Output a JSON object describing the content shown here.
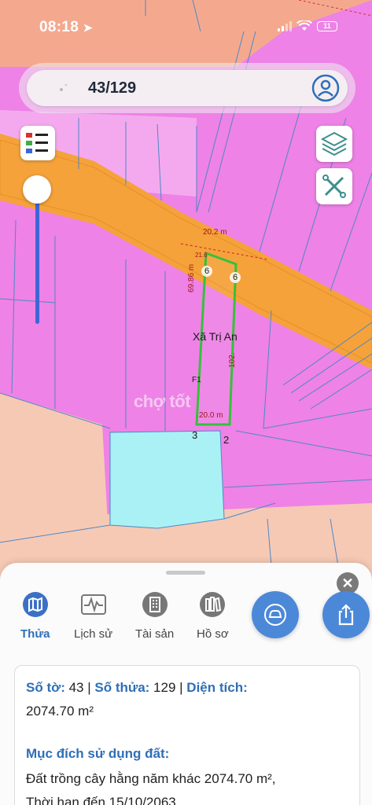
{
  "status_bar": {
    "time": "08:18",
    "battery": "11"
  },
  "search": {
    "value": "43/129"
  },
  "map": {
    "commune_label": "Xã Trị An",
    "watermark": "chợ tốt",
    "dimensions": {
      "top": "20.2 m",
      "left": "69.86 m",
      "right": "102.",
      "bottom": "20.0 m",
      "left_top": "21.6"
    },
    "parcel_numbers": [
      "6",
      "6",
      "3",
      "2",
      "F1"
    ]
  },
  "tabs": [
    {
      "label": "Thửa",
      "icon": "map-icon",
      "active": true
    },
    {
      "label": "Lịch sử",
      "icon": "history-chart-icon",
      "active": false
    },
    {
      "label": "Tài sản",
      "icon": "building-icon",
      "active": false
    },
    {
      "label": "Hồ sơ",
      "icon": "books-icon",
      "active": false
    }
  ],
  "actions": {
    "car": "car-icon",
    "share": "share-icon"
  },
  "info": {
    "so_to_label": "Số tờ:",
    "so_to_value": "43",
    "so_thua_label": "Số thửa:",
    "so_thua_value": "129",
    "dien_tich_label": "Diện tích:",
    "dien_tich_value": "2074.70 m²",
    "muc_dich_label": "Mục đích sử dụng đất:",
    "muc_dich_value": "Đất trồng cây hằng năm khác 2074.70 m²,",
    "thoi_han": "Thời hạn đến 15/10/2063"
  },
  "colors": {
    "land_pink": "#ee82e6",
    "road_orange": "#f5a23a",
    "residential": "#f6c9b5",
    "water": "#aaf1f5",
    "parcel_outline": "#35c13a",
    "accent_blue": "#2f6fb7"
  }
}
